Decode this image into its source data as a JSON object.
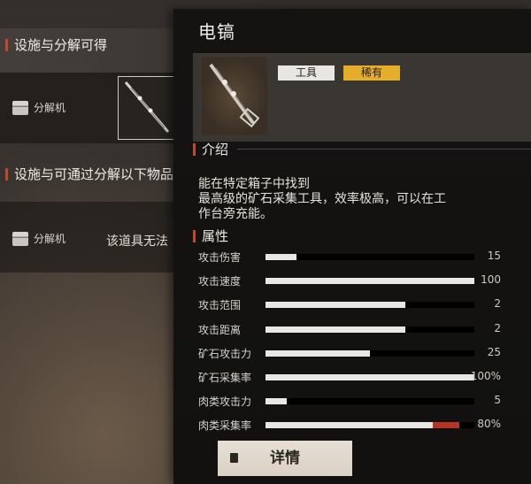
{
  "left": {
    "section1_title": "设施与分解可得",
    "section2_title": "设施与可通过分解以下物品",
    "machine1_label": "分解机",
    "machine2_label": "分解机",
    "note": "该道具无法"
  },
  "tooltip": {
    "title": "电镐",
    "tags": [
      "工具",
      "稀有"
    ],
    "intro_title": "介绍",
    "description": [
      "能在特定箱子中找到",
      "最高级的矿石采集工具，效率极高，可以在工",
      "作台旁充能。"
    ],
    "attr_title": "属性",
    "stats": [
      {
        "label": "攻击伤害",
        "value": "15",
        "fill": 0.15
      },
      {
        "label": "攻击速度",
        "value": "100",
        "fill": 1.0
      },
      {
        "label": "攻击范围",
        "value": "2",
        "fill": 0.67
      },
      {
        "label": "攻击距离",
        "value": "2",
        "fill": 0.67
      },
      {
        "label": "矿石攻击力",
        "value": "25",
        "fill": 0.5
      },
      {
        "label": "矿石采集率",
        "value": "100%",
        "fill": 1.0
      },
      {
        "label": "肉类攻击力",
        "value": "5",
        "fill": 0.1
      },
      {
        "label": "肉类采集率",
        "value": "80%",
        "fill": 0.8,
        "extra": 0.13
      }
    ],
    "detail_button": "详情"
  },
  "colors": {
    "accent": "#c2472f",
    "rare": "#e5ad2a",
    "bar_fill": "#e9e7e3"
  }
}
